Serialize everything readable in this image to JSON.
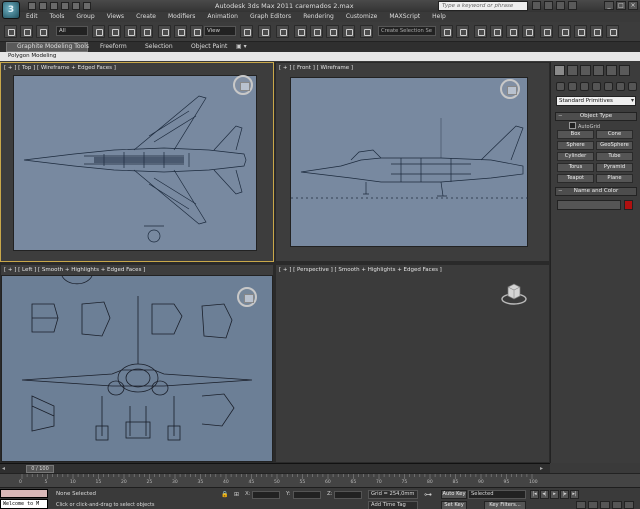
{
  "window": {
    "title": "Autodesk 3ds Max  2011      caremados 2.max",
    "search_placeholder": "Type a keyword or phrase"
  },
  "menu": [
    "Edit",
    "Tools",
    "Group",
    "Views",
    "Create",
    "Modifiers",
    "Animation",
    "Graph Editors",
    "Rendering",
    "Customize",
    "MAXScript",
    "Help"
  ],
  "toolbar": {
    "selection_filter": "All",
    "reference_coord": "View",
    "named_selection_placeholder": "Create Selection Se"
  },
  "ribbon": {
    "tabs": [
      "Graphite Modeling Tools",
      "Freeform",
      "Selection",
      "Object Paint"
    ],
    "active_tab": "Graphite Modeling Tools",
    "subpanel": "Polygon Modeling"
  },
  "viewports": {
    "top": "[ + ] [ Top ] [ Wireframe + Edged Faces ]",
    "front": "[ + ] [ Front ] [ Wireframe ]",
    "left": "[ + ] [ Left ] [ Smooth + Highlights + Edged Faces ]",
    "perspective": "[ + ] [ Perspective ] [ Smooth + Highlights + Edged Faces ]"
  },
  "command_panel": {
    "category": "Standard Primitives",
    "object_type_title": "Object Type",
    "autogrid_label": "AutoGrid",
    "buttons": [
      "Box",
      "Cone",
      "Sphere",
      "GeoSphere",
      "Cylinder",
      "Tube",
      "Torus",
      "Pyramid",
      "Teapot",
      "Plane"
    ],
    "name_color_title": "Name and Color",
    "object_color": "#b01010"
  },
  "timeline": {
    "frame_indicator": "0 / 100",
    "ticks": [
      "0",
      "5",
      "10",
      "15",
      "20",
      "25",
      "30",
      "35",
      "40",
      "45",
      "50",
      "55",
      "60",
      "65",
      "70",
      "75",
      "80",
      "85",
      "90",
      "95",
      "100"
    ]
  },
  "status": {
    "maxscript_text": "Welcome to M",
    "selection_status": "None Selected",
    "prompt": "Click or click-and-drag to select objects",
    "x_label": "X:",
    "y_label": "Y:",
    "z_label": "Z:",
    "grid": "Grid = 254,0mm",
    "add_time_tag": "Add Time Tag",
    "auto_key": "Auto Key",
    "set_key": "Set Key",
    "key_mode": "Selected",
    "key_filters": "Key Filters..."
  }
}
